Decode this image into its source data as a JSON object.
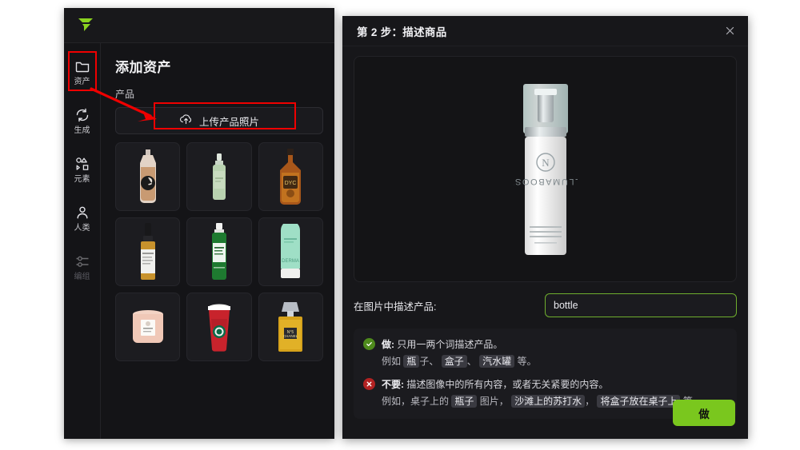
{
  "app": {
    "logo_name": "flair-logo",
    "sidebar": {
      "items": [
        {
          "label": "资产",
          "icon": "folder-icon",
          "active": true
        },
        {
          "label": "生成",
          "icon": "refresh-icon",
          "active": false
        },
        {
          "label": "元素",
          "icon": "shapes-icon",
          "active": false
        },
        {
          "label": "人类",
          "icon": "person-icon",
          "active": false
        },
        {
          "label": "编组",
          "icon": "nodes-icon",
          "active": false
        }
      ]
    },
    "content": {
      "page_title": "添加资产",
      "section_label": "产品",
      "upload_button_label": "上传产品照片",
      "upload_icon": "upload-cloud-icon",
      "thumbnails": [
        {
          "name": "foundation-bottle"
        },
        {
          "name": "green-spray-bottle"
        },
        {
          "name": "whiskey-bottle"
        },
        {
          "name": "serum-dropper-bottle"
        },
        {
          "name": "green-toner-bottle"
        },
        {
          "name": "mint-cream-tube"
        },
        {
          "name": "candle-jar"
        },
        {
          "name": "starbucks-cup"
        },
        {
          "name": "perfume-bottle"
        }
      ]
    }
  },
  "modal": {
    "title": "第 2 步：描述商品",
    "close_icon": "close-icon",
    "preview": {
      "name": "illumaboost-pump-bottle",
      "brand_mark": "N",
      "product_text": "ILLUMABOOST",
      "sub_text_1": "BRIGHTENING BOOSTER",
      "sub_text_2": "UNIVERSELLE ECLAIRCISSANT",
      "sub_text_3": "ILUMINADOR Y PROTECTOR",
      "volume_text": "2.5 fl oz / 75 ml"
    },
    "description": {
      "label": "在图片中描述产品:",
      "value": "bottle",
      "placeholder": "bottle"
    },
    "tips": {
      "do": {
        "badge_icon": "check-icon",
        "title": "做:",
        "text": "只用一两个词描述产品。",
        "example_prefix": "例如",
        "chips": [
          "瓶",
          "盒子",
          "汽水罐"
        ],
        "after_chip_1": "子、",
        "after_chip_2": "、",
        "example_suffix": "等。"
      },
      "dont": {
        "badge_icon": "x-icon",
        "title": "不要:",
        "text": "描述图像中的所有内容，或者无关紧要的内容。",
        "example_prefix": "例如，桌子上的",
        "chip_1": "瓶子",
        "mid_1": "图片，",
        "chip_2": "沙滩上的苏打水",
        "mid_2": "，",
        "chip_3": "将盒子放在桌子上",
        "example_suffix": "等。"
      }
    },
    "primary_button_label": "做"
  },
  "annotations": {
    "color": "#ef0000",
    "boxes": [
      {
        "name": "sidebar-assets-highlight"
      },
      {
        "name": "upload-button-highlight"
      }
    ],
    "arrow": {
      "name": "pointer-arrow"
    }
  },
  "colors": {
    "accent_green": "#7ac71e",
    "input_border": "#6fae2e",
    "annotation_red": "#ef0000",
    "panel_bg": "#17171a",
    "app_bg": "#141417"
  }
}
